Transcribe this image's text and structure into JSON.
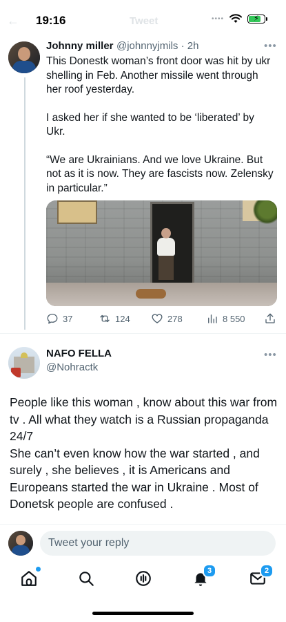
{
  "status_bar": {
    "time": "19:16",
    "header_title": "Tweet",
    "icons": [
      "dots-icon",
      "wifi-icon",
      "battery-charging-icon"
    ]
  },
  "tweet": {
    "author_name": "Johnny miller",
    "author_meta": "@johnnyjmils · 2h",
    "paragraphs": [
      "This Donestk woman’s front door was hit by ukr shelling in Feb. Another missile went through her roof yesterday.",
      "I asked her if she wanted to be ‘liberated’ by Ukr.",
      "“We are Ukrainians. And we love Ukraine. But not as it is now. They are fascists now. Zelensky in particular.”"
    ],
    "actions": {
      "replies": "37",
      "retweets": "124",
      "likes": "278",
      "views": "8 550"
    }
  },
  "reply": {
    "author_name": "NAFO FELLA",
    "author_handle": "@Nohractk",
    "paragraphs": [
      "People like this woman , know about this war from tv . All what they watch is a Russian propaganda 24/7",
      "She can’t even know how the war started , and surely , she believes , it is Americans and Europeans started the war in Ukraine . Most of Donetsk people are confused ."
    ]
  },
  "reply_bar": {
    "placeholder": "Tweet your reply"
  },
  "tab_bar": {
    "items": [
      {
        "name": "home",
        "icon": "home-icon"
      },
      {
        "name": "search",
        "icon": "search-icon"
      },
      {
        "name": "spaces",
        "icon": "spaces-icon"
      },
      {
        "name": "notifications",
        "icon": "bell-icon",
        "badge": "3"
      },
      {
        "name": "messages",
        "icon": "mail-icon",
        "badge": "2"
      }
    ]
  },
  "colors": {
    "accent": "#1d9bf0",
    "text": "#0f1419",
    "secondary": "#536471"
  }
}
